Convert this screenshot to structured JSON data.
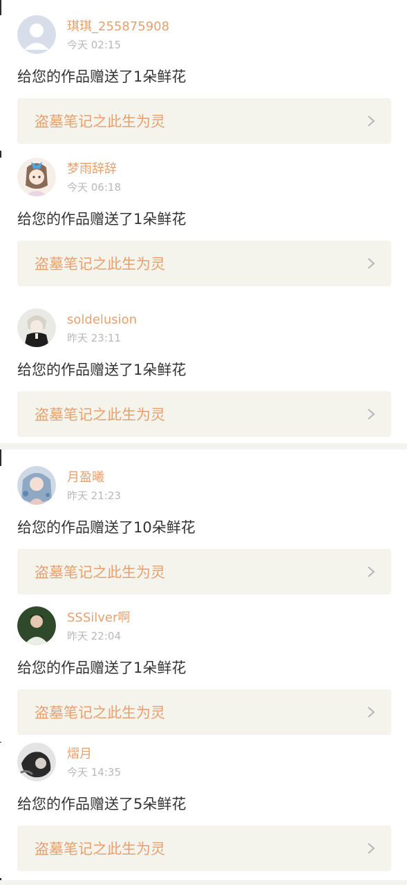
{
  "colors": {
    "accent": "#e8a06e",
    "card_bg": "#f4f3ec",
    "message_text": "#333333",
    "time_text": "#b8b8b8",
    "divider": "#f3f3f1"
  },
  "items": [
    {
      "username": "琪琪_255875908",
      "time": "今天 02:15",
      "message": "给您的作品赠送了1朵鲜花",
      "work_title": "盗墓笔记之此生为灵",
      "avatar": "default-avatar-icon"
    },
    {
      "username": "梦雨辞辞",
      "time": "今天 06:18",
      "message": "给您的作品赠送了1朵鲜花",
      "work_title": "盗墓笔记之此生为灵",
      "avatar": "anime-girl-avatar"
    },
    {
      "username": "soldelusion",
      "time": "昨天 23:11",
      "message": "给您的作品赠送了1朵鲜花",
      "work_title": "盗墓笔记之此生为灵",
      "avatar": "anime-boy-avatar"
    },
    {
      "username": "月盈曦",
      "time": "昨天 21:23",
      "message": "给您的作品赠送了10朵鲜花",
      "work_title": "盗墓笔记之此生为灵",
      "avatar": "illustration-avatar"
    },
    {
      "username": "SSSilver啊",
      "time": "昨天 22:04",
      "message": "给您的作品赠送了1朵鲜花",
      "work_title": "盗墓笔记之此生为灵",
      "avatar": "photo-avatar"
    },
    {
      "username": "熠月",
      "time": "今天 14:35",
      "message": "给您的作品赠送了5朵鲜花",
      "work_title": "盗墓笔记之此生为灵",
      "avatar": "dark-photo-avatar"
    }
  ]
}
